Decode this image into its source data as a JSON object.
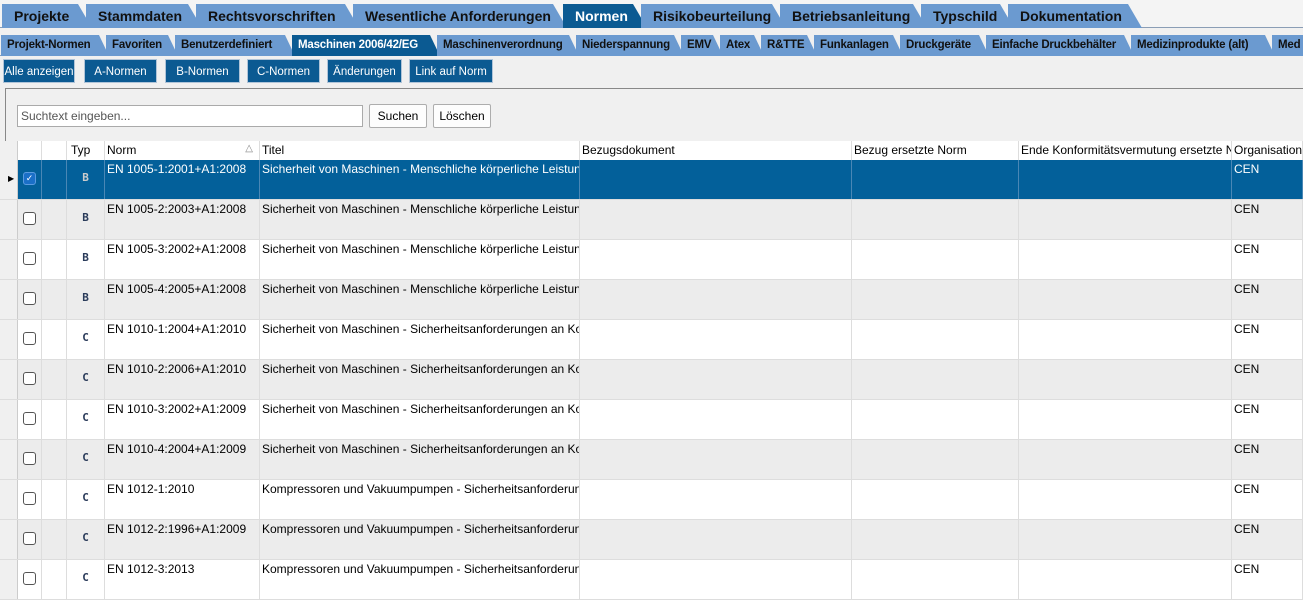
{
  "main_tabs": [
    "Projekte",
    "Stammdaten",
    "Rechtsvorschriften",
    "Wesentliche Anforderungen",
    "Normen",
    "Risikobeurteilung",
    "Betriebsanleitung",
    "Typschild",
    "Dokumentation"
  ],
  "sub_tabs": [
    "Projekt-Normen",
    "Favoriten",
    "Benutzerdefiniert",
    "Maschinen 2006/42/EG",
    "Maschinenverordnung",
    "Niederspannung",
    "EMV",
    "Atex",
    "R&TTE",
    "Funkanlagen",
    "Druckgeräte",
    "Einfache Druckbehälter",
    "Medizinprodukte (alt)",
    "Med"
  ],
  "filter_buttons": [
    "Alle anzeigen",
    "A-Normen",
    "B-Normen",
    "C-Normen",
    "Änderungen",
    "Link auf Norm"
  ],
  "search": {
    "placeholder": "Suchtext eingeben...",
    "search_label": "Suchen",
    "clear_label": "Löschen"
  },
  "columns": [
    "Typ",
    "Norm",
    "Titel",
    "Bezugsdokument",
    "Bezug ersetzte Norm",
    "Ende Konformitätsvermutung ersetzte Norm",
    "Organisation"
  ],
  "sort_indicator": "△",
  "rows": [
    {
      "typ": "B",
      "norm": "EN 1005-1:2001+A1:2008",
      "titel": "Sicherheit von Maschinen - Menschliche körperliche Leistung - Teil",
      "org": "CEN",
      "checked": true,
      "selected": true
    },
    {
      "typ": "B",
      "norm": "EN 1005-2:2003+A1:2008",
      "titel": "Sicherheit von Maschinen - Menschliche körperliche Leistung - Teil",
      "org": "CEN"
    },
    {
      "typ": "B",
      "norm": "EN 1005-3:2002+A1:2008",
      "titel": "Sicherheit von Maschinen - Menschliche körperliche Leistung - Teil",
      "org": "CEN"
    },
    {
      "typ": "B",
      "norm": "EN 1005-4:2005+A1:2008",
      "titel": "Sicherheit von Maschinen - Menschliche körperliche Leistung - Teil",
      "org": "CEN"
    },
    {
      "typ": "C",
      "norm": "EN 1010-1:2004+A1:2010",
      "titel": "Sicherheit von Maschinen - Sicherheitsanforderungen an Konstruk",
      "org": "CEN"
    },
    {
      "typ": "C",
      "norm": "EN 1010-2:2006+A1:2010",
      "titel": "Sicherheit von Maschinen - Sicherheitsanforderungen an Konstruk",
      "org": "CEN"
    },
    {
      "typ": "C",
      "norm": "EN 1010-3:2002+A1:2009",
      "titel": "Sicherheit von Maschinen - Sicherheitsanforderungen an Konstruk",
      "org": "CEN"
    },
    {
      "typ": "C",
      "norm": "EN 1010-4:2004+A1:2009",
      "titel": "Sicherheit von Maschinen - Sicherheitsanforderungen an Konstruk",
      "org": "CEN"
    },
    {
      "typ": "C",
      "norm": "EN 1012-1:2010",
      "titel": "Kompressoren und Vakuumpumpen - Sicherheitsanforderungen - T",
      "org": "CEN"
    },
    {
      "typ": "C",
      "norm": "EN 1012-2:1996+A1:2009",
      "titel": "Kompressoren und Vakuumpumpen - Sicherheitsanforderungen - T",
      "org": "CEN"
    },
    {
      "typ": "C",
      "norm": "EN 1012-3:2013",
      "titel": "Kompressoren und Vakuumpumpen - Sicherheitsanforderungen - T",
      "org": "CEN"
    }
  ]
}
